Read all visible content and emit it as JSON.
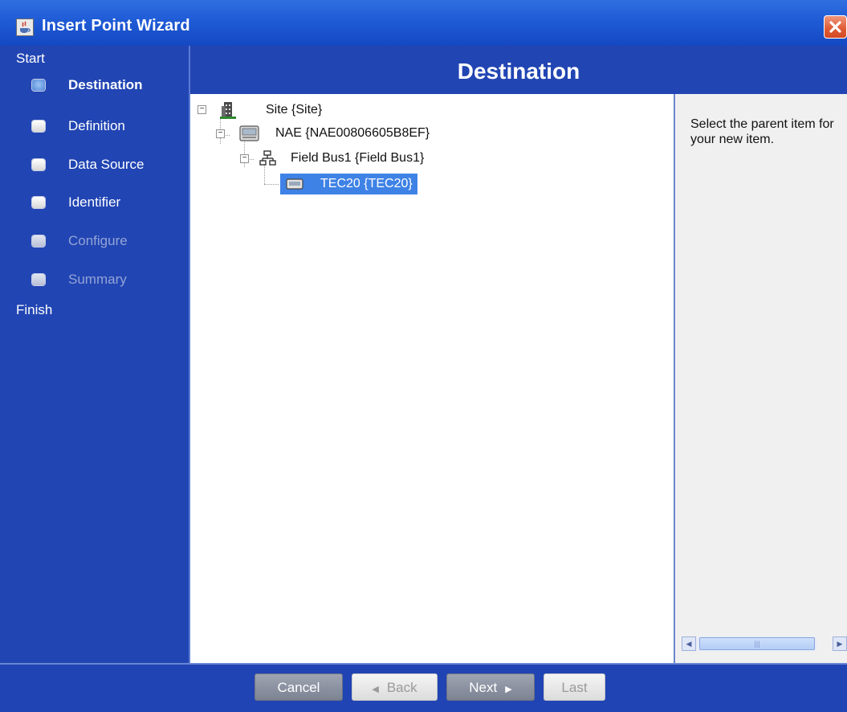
{
  "window": {
    "title": "Insert Point Wizard"
  },
  "sidebar": {
    "start_label": "Start",
    "finish_label": "Finish",
    "steps": [
      {
        "label": "Destination",
        "state": "current"
      },
      {
        "label": "Definition",
        "state": "enabled"
      },
      {
        "label": "Data Source",
        "state": "enabled"
      },
      {
        "label": "Identifier",
        "state": "enabled"
      },
      {
        "label": "Configure",
        "state": "disabled"
      },
      {
        "label": "Summary",
        "state": "disabled"
      }
    ]
  },
  "header": {
    "title": "Destination"
  },
  "tree": {
    "nodes": [
      {
        "label": "Site {Site}",
        "icon": "building-icon",
        "expanded": true
      },
      {
        "label": "NAE {NAE00806605B8EF}",
        "icon": "device-icon",
        "expanded": true
      },
      {
        "label": "Field Bus1 {Field Bus1}",
        "icon": "network-icon",
        "expanded": true
      },
      {
        "label": "TEC20 {TEC20}",
        "icon": "controller-icon",
        "selected": true
      }
    ]
  },
  "help": {
    "text": "Select the parent item for your new item."
  },
  "footer": {
    "cancel_label": "Cancel",
    "back_label": "Back",
    "next_label": "Next",
    "last_label": "Last"
  },
  "colors": {
    "window_blue": "#2145b3",
    "selection": "#3f82e6",
    "title_bar": "#1f5bd6"
  }
}
